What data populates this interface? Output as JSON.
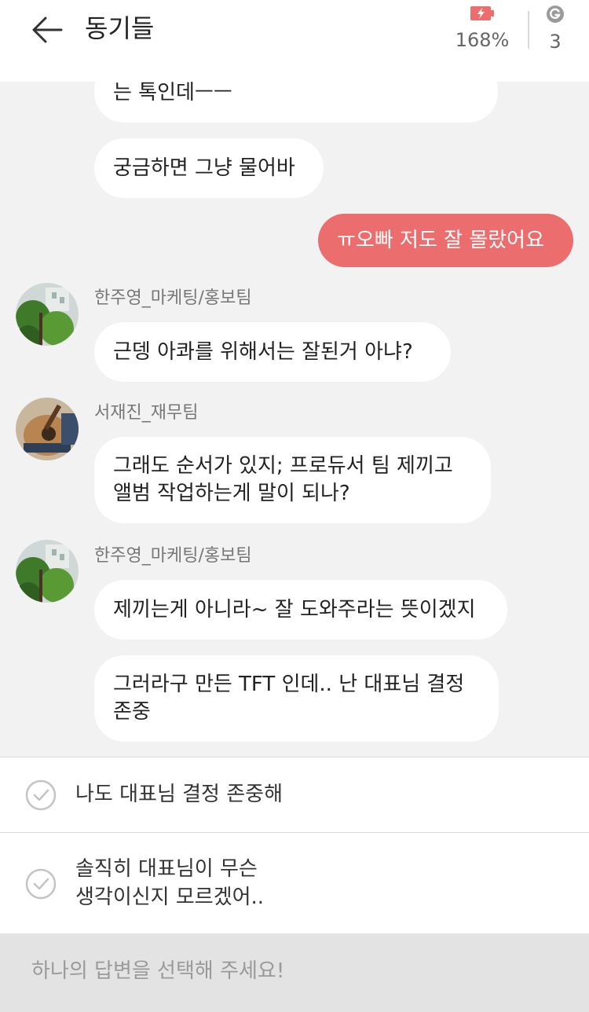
{
  "header": {
    "title": "동기들",
    "battery_value": "168%",
    "coin_value": "3",
    "battery_color": "#ec6d6d",
    "coin_icon": "g-coin-icon"
  },
  "messages": [
    {
      "type": "text",
      "side": "left",
      "text": "는 톡인데ㅡㅡ"
    },
    {
      "type": "text",
      "side": "left",
      "text": "궁금하면 그냥 물어바"
    },
    {
      "type": "text",
      "side": "right",
      "text": "ㅠ오빠 저도 잘 몰랐어요"
    },
    {
      "type": "sender",
      "name": "한주영_마케팅/홍보팀"
    },
    {
      "type": "text",
      "side": "left",
      "text": "근뎅 아콰를 위해서는 잘된거 아냐?"
    },
    {
      "type": "sender",
      "name": "서재진_재무팀"
    },
    {
      "type": "text",
      "side": "left",
      "text": "그래도 순서가 있지; 프로듀서 팀 제끼고\n앨범 작업하는게 말이 되나?"
    },
    {
      "type": "sender",
      "name": "한주영_마케팅/홍보팀"
    },
    {
      "type": "text",
      "side": "left",
      "text": "제끼는게 아니라~ 잘 도와주라는 뜻이겠지"
    },
    {
      "type": "text",
      "side": "left",
      "text": "그러라구 만든 TFT 인데.. 난 대표님 결정\n존중"
    }
  ],
  "choices": [
    {
      "text": "나도 대표님 결정 존중해"
    },
    {
      "text": "솔직히 대표님이 무슨\n생각이신지 모르겠어.."
    }
  ],
  "footer": {
    "hint": "하나의 답변을 선택해 주세요!"
  },
  "colors": {
    "accent": "#ec6d6d",
    "background": "#f2f2f2"
  }
}
